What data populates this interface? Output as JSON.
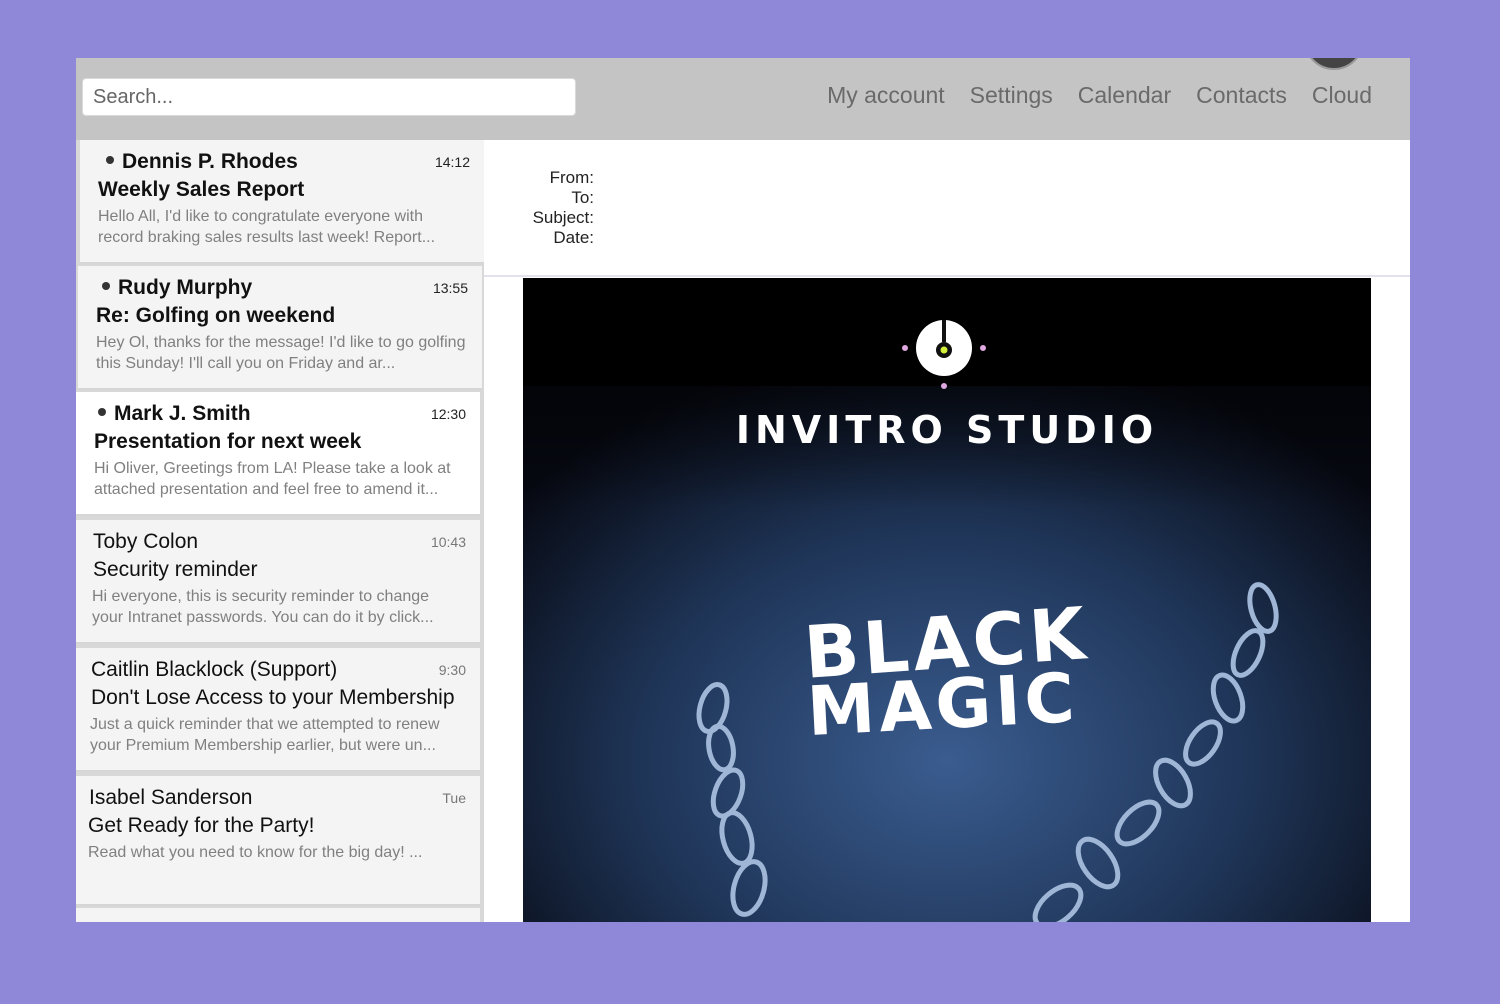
{
  "search": {
    "placeholder": "Search..."
  },
  "nav": [
    "My account",
    "Settings",
    "Calendar",
    "Contacts",
    "Cloud"
  ],
  "emails": [
    {
      "sender": "Dennis P. Rhodes",
      "time": "14:12",
      "subject": "Weekly Sales Report",
      "preview": "Hello All, I'd like to congratulate everyone with record braking sales results last week! Report...",
      "unread": true
    },
    {
      "sender": "Rudy Murphy",
      "time": "13:55",
      "subject": "Re: Golfing on weekend",
      "preview": "Hey Ol, thanks for the message! I'd like to go golfing this Sunday! I'll call you on Friday and ar...",
      "unread": true
    },
    {
      "sender": "Mark J. Smith",
      "time": "12:30",
      "subject": "Presentation for next week",
      "preview": "Hi Oliver, Greetings from LA! Please take a look at attached presentation and feel free to amend it...",
      "unread": true
    },
    {
      "sender": "Toby Colon",
      "time": "10:43",
      "subject": "Security reminder",
      "preview": "Hi everyone, this is security reminder to change your Intranet passwords. You can do it by click...",
      "unread": false
    },
    {
      "sender": "Caitlin Blacklock (Support)",
      "time": "9:30",
      "subject": "Don't Lose Access to your Membership",
      "preview": "Just a quick reminder that we attempted to renew your Premium Membership earlier, but were un...",
      "unread": false
    },
    {
      "sender": "Isabel Sanderson",
      "time": "Tue",
      "subject": "Get Ready for the Party!",
      "preview": "Read what you need to know for the big day! ...",
      "unread": false
    }
  ],
  "message_header": {
    "from": "From:",
    "to": "To:",
    "subject": "Subject:",
    "date": "Date:"
  },
  "message_body": {
    "brand": "INVITRO STUDIO",
    "line1": "BLACK",
    "line2": "MAGIC"
  },
  "colors": {
    "background": "#8f88d9",
    "topbar": "#c4c4c4",
    "email_body_bg": "#0a0c14"
  }
}
